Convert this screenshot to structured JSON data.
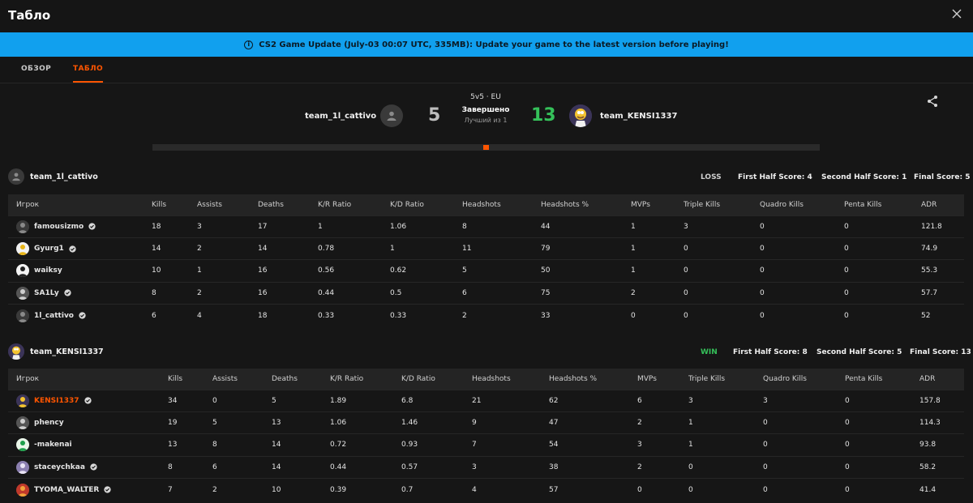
{
  "window": {
    "title": "Табло"
  },
  "banner": {
    "text": "CS2 Game Update (July-03 00:07 UTC, 335MB): Update your game to the latest version before playing!"
  },
  "tabs": [
    {
      "label": "ОБЗОР",
      "active": false
    },
    {
      "label": "ТАБЛО",
      "active": true
    }
  ],
  "match": {
    "team1": {
      "name": "team_1l_cattivo",
      "score": "5"
    },
    "team2": {
      "name": "team_KENSI1337",
      "score": "13"
    },
    "format": "5v5 · EU",
    "status": "Завершено",
    "best_of": "Лучший из 1",
    "progress": 0.5
  },
  "colors": {
    "accent": "#ff5500",
    "win": "#35c15a",
    "banner": "#11a0ee"
  },
  "teams": [
    {
      "name": "team_1l_cattivo",
      "result": "LOSS",
      "first_half": "First Half Score: 4",
      "second_half": "Second Half Score: 1",
      "final": "Final Score: 5",
      "columns": [
        "Игрок",
        "Kills",
        "Assists",
        "Deaths",
        "K/R Ratio",
        "K/D Ratio",
        "Headshots",
        "Headshots %",
        "MVPs",
        "Triple Kills",
        "Quadro Kills",
        "Penta Kills",
        "ADR"
      ],
      "players": [
        {
          "name": "famousizmo",
          "avatar": "default",
          "verified": true,
          "stats": [
            "18",
            "3",
            "17",
            "1",
            "1.06",
            "8",
            "44",
            "1",
            "3",
            "0",
            "0",
            "121.8"
          ]
        },
        {
          "name": "Gyurg1",
          "avatar": "yellow",
          "verified": true,
          "stats": [
            "14",
            "2",
            "14",
            "0.78",
            "1",
            "11",
            "79",
            "1",
            "0",
            "0",
            "0",
            "74.9"
          ]
        },
        {
          "name": "waiksy",
          "avatar": "white",
          "verified": false,
          "stats": [
            "10",
            "1",
            "16",
            "0.56",
            "0.62",
            "5",
            "50",
            "1",
            "0",
            "0",
            "0",
            "55.3"
          ]
        },
        {
          "name": "SA1Ly",
          "avatar": "gray",
          "verified": true,
          "stats": [
            "8",
            "2",
            "16",
            "0.44",
            "0.5",
            "6",
            "75",
            "2",
            "0",
            "0",
            "0",
            "57.7"
          ]
        },
        {
          "name": "1l_cattivo",
          "avatar": "default",
          "verified": true,
          "stats": [
            "6",
            "4",
            "18",
            "0.33",
            "0.33",
            "2",
            "33",
            "0",
            "0",
            "0",
            "0",
            "52"
          ]
        }
      ]
    },
    {
      "name": "team_KENSI1337",
      "result": "WIN",
      "first_half": "First Half Score: 8",
      "second_half": "Second Half Score: 5",
      "final": "Final Score: 13",
      "columns": [
        "Игрок",
        "Kills",
        "Assists",
        "Deaths",
        "K/R Ratio",
        "K/D Ratio",
        "Headshots",
        "Headshots %",
        "MVPs",
        "Triple Kills",
        "Quadro Kills",
        "Penta Kills",
        "ADR"
      ],
      "players": [
        {
          "name": "KENSI1337",
          "avatar": "homer",
          "verified": true,
          "highlight": true,
          "stats": [
            "34",
            "0",
            "5",
            "1.89",
            "6.8",
            "21",
            "62",
            "6",
            "3",
            "3",
            "0",
            "157.8"
          ]
        },
        {
          "name": "phency",
          "avatar": "gray",
          "verified": false,
          "stats": [
            "19",
            "5",
            "13",
            "1.06",
            "1.46",
            "9",
            "47",
            "2",
            "1",
            "0",
            "0",
            "114.3"
          ]
        },
        {
          "name": "-makenai",
          "avatar": "green",
          "verified": false,
          "stats": [
            "13",
            "8",
            "14",
            "0.72",
            "0.93",
            "7",
            "54",
            "3",
            "1",
            "0",
            "0",
            "93.8"
          ]
        },
        {
          "name": "staceychkaa",
          "avatar": "purple",
          "verified": true,
          "stats": [
            "8",
            "6",
            "14",
            "0.44",
            "0.57",
            "3",
            "38",
            "2",
            "0",
            "0",
            "0",
            "58.2"
          ]
        },
        {
          "name": "TYOMA_WALTER",
          "avatar": "orange",
          "verified": true,
          "stats": [
            "7",
            "2",
            "10",
            "0.39",
            "0.7",
            "4",
            "57",
            "0",
            "0",
            "0",
            "0",
            "41.4"
          ]
        }
      ]
    }
  ]
}
